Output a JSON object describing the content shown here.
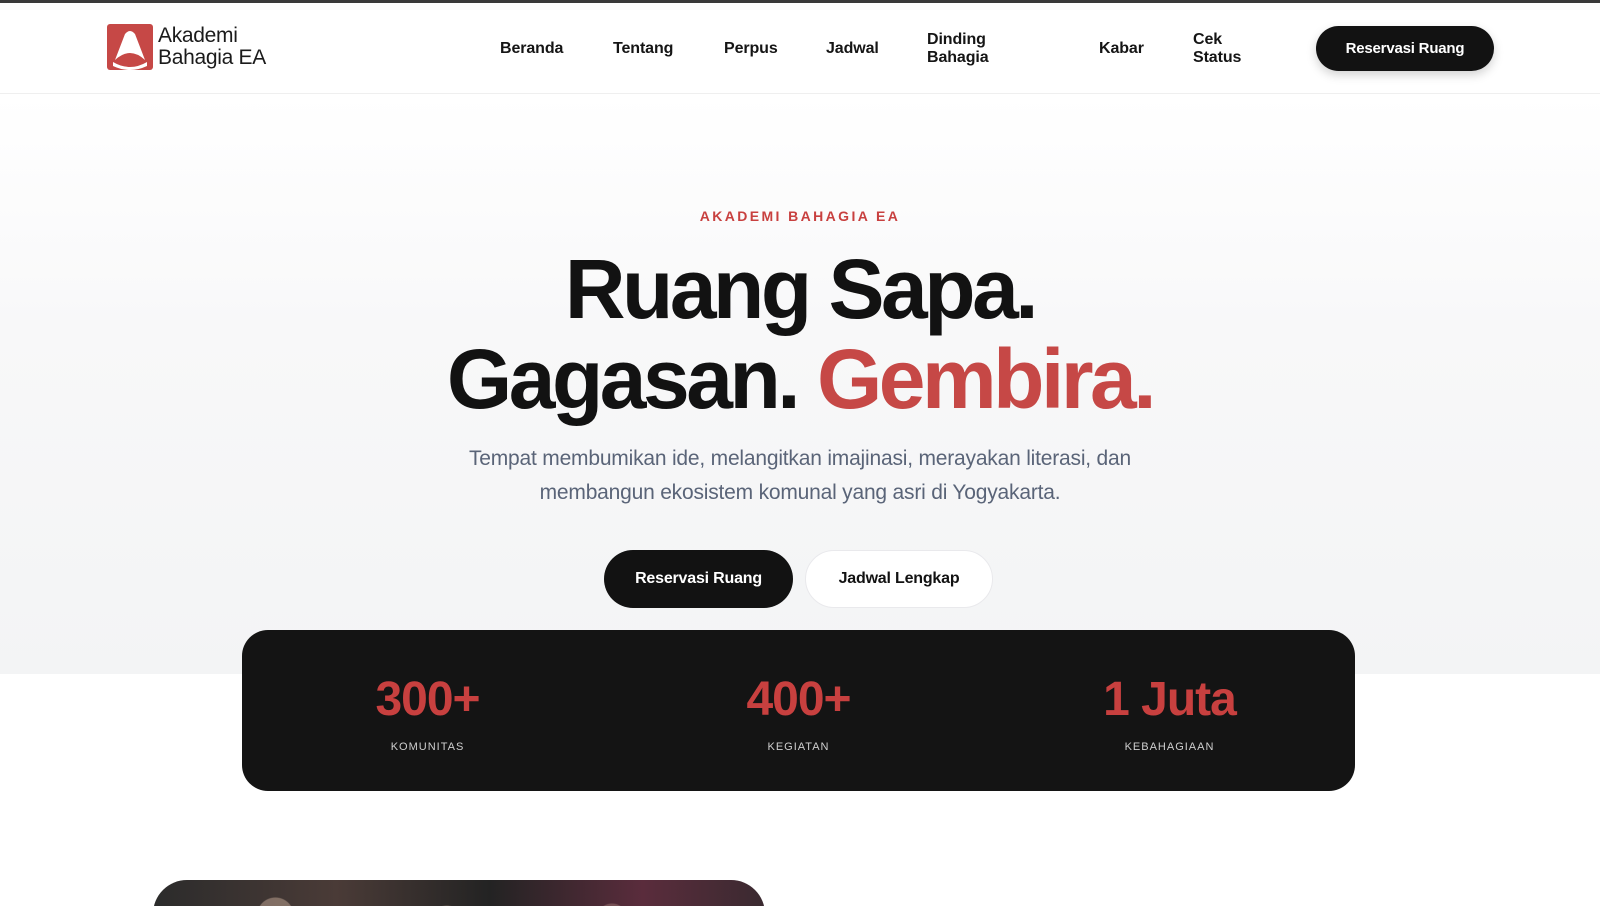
{
  "brand": {
    "logo_icon": "akademi-bahagia-logo",
    "name_line1": "Akademi",
    "name_line2": "Bahagia EA"
  },
  "nav": {
    "items": [
      {
        "label": "Beranda"
      },
      {
        "label": "Tentang"
      },
      {
        "label": "Perpus"
      },
      {
        "label": "Jadwal"
      },
      {
        "label": "Dinding Bahagia"
      },
      {
        "label": "Kabar"
      },
      {
        "label": "Cek Status"
      }
    ],
    "cta_label": "Reservasi Ruang"
  },
  "hero": {
    "eyebrow": "AKADEMI BAHAGIA EA",
    "headline_line1": "Ruang Sapa.",
    "headline_line2_part1": "Gagasan.",
    "headline_line2_accent": "Gembira.",
    "subtitle_line1": "Tempat membumikan ide, melangitkan imajinasi, merayakan literasi, dan",
    "subtitle_line2": "membangun ekosistem komunal yang asri di Yogyakarta.",
    "primary_button": "Reservasi Ruang",
    "secondary_button": "Jadwal Lengkap"
  },
  "stats": [
    {
      "value": "300+",
      "label": "KOMUNITAS"
    },
    {
      "value": "400+",
      "label": "KEGIATAN"
    },
    {
      "value": "1 Juta",
      "label": "KEBAHAGIAAN"
    }
  ],
  "colors": {
    "accent": "#c8403f",
    "dark": "#121212",
    "subtitle": "#5a6478"
  }
}
